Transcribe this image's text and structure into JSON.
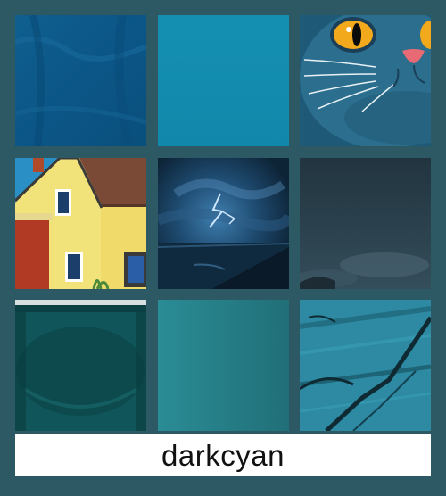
{
  "colors": {
    "border": "#2d5964",
    "caption_bg": "#ffffff",
    "caption_text": "#111111"
  },
  "grid": {
    "tiles": [
      {
        "id": "fabric",
        "icon": "blue-fabric-image"
      },
      {
        "id": "solid",
        "icon": "teal-solid-image"
      },
      {
        "id": "cat",
        "icon": "blue-cat-image"
      },
      {
        "id": "house",
        "icon": "yellow-house-image"
      },
      {
        "id": "storm",
        "icon": "lightning-storm-image"
      },
      {
        "id": "fog",
        "icon": "dark-fog-image"
      },
      {
        "id": "mug",
        "icon": "teal-mug-image"
      },
      {
        "id": "gradient",
        "icon": "teal-gradient-image"
      },
      {
        "id": "wood",
        "icon": "teal-wood-image"
      }
    ]
  },
  "caption": {
    "label": "darkcyan"
  }
}
